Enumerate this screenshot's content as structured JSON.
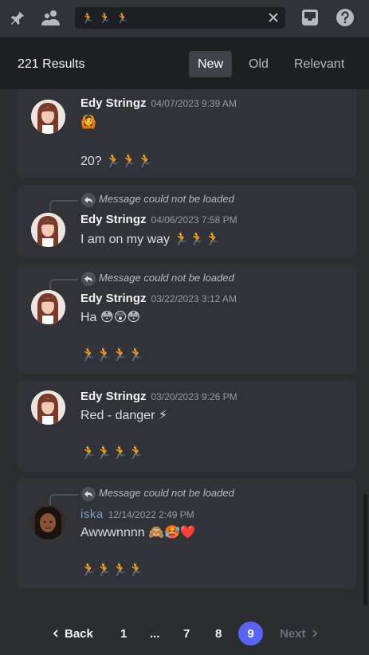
{
  "toolbar": {
    "icons": [
      "pin-icon",
      "members-icon",
      "inbox-icon",
      "help-icon"
    ],
    "search_query": "🏃 🏃 🏃",
    "clear_label": "×"
  },
  "results_header": {
    "count": "221 Results",
    "sort_options": [
      "New",
      "Old",
      "Relevant"
    ],
    "active_sort": "New"
  },
  "reply_unavailable": "Message could not be loaded",
  "messages": [
    {
      "author": "Edy Stringz",
      "timestamp": "04/07/2023 9:39 AM",
      "lines": [
        "🙆",
        "20? 🏃🏃🏃"
      ]
    },
    {
      "author": "Edy Stringz",
      "timestamp": "04/06/2023 7:58 PM",
      "lines": [
        "I am on my way 🏃🏃🏃"
      ]
    },
    {
      "author": "Edy Stringz",
      "timestamp": "03/22/2023 3:12 AM",
      "lines": [
        "Ha 😳😲😳",
        "🏃🏃🏃🏃"
      ]
    },
    {
      "author": "Edy Stringz",
      "timestamp": "03/20/2023 9:26 PM",
      "lines": [
        "Red - danger ⚡",
        "🏃🏃🏃🏃"
      ]
    },
    {
      "author": "iska",
      "timestamp": "12/14/2022 2:49 PM",
      "lines": [
        "Awwwnnnn 🙈🥵❤️",
        "🏃🏃🏃🏃"
      ]
    }
  ],
  "pagination": {
    "back": "Back",
    "pages": [
      "1",
      "...",
      "7",
      "8",
      "9"
    ],
    "current": "9",
    "next": "Next"
  },
  "colors": {
    "accent": "#5865f2",
    "background": "#2b2d31",
    "card": "#313338",
    "header": "#1e1f22"
  }
}
